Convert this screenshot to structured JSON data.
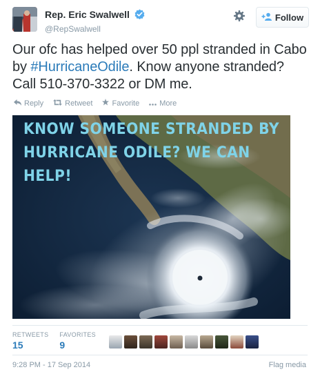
{
  "author": {
    "display_name": "Rep. Eric Swalwell",
    "handle": "@RepSwalwell",
    "verified_icon": "verified-badge-icon"
  },
  "header": {
    "settings_icon": "gear-icon",
    "follow_label": "Follow"
  },
  "tweet": {
    "text_before": "Our ofc has helped over 50 ppl stranded in Cabo by ",
    "hashtag": "#HurricaneOdile",
    "text_after": ". Know anyone stranded? Call 510-370-3322 or DM me."
  },
  "actions": {
    "reply": "Reply",
    "retweet": "Retweet",
    "favorite": "Favorite",
    "more": "More"
  },
  "media": {
    "caption_line1": "Know someone stranded by",
    "caption_line2": "Hurricane Odile? We can help!"
  },
  "stats": {
    "retweets_label": "RETWEETS",
    "retweets_count": "15",
    "favorites_label": "FAVORITES",
    "favorites_count": "9"
  },
  "footer": {
    "timestamp": "9:28 PM - 17 Sep 2014",
    "flag_media": "Flag media"
  },
  "colors": {
    "link": "#2b7bb9",
    "muted": "#8899a6",
    "verified": "#55acee"
  }
}
